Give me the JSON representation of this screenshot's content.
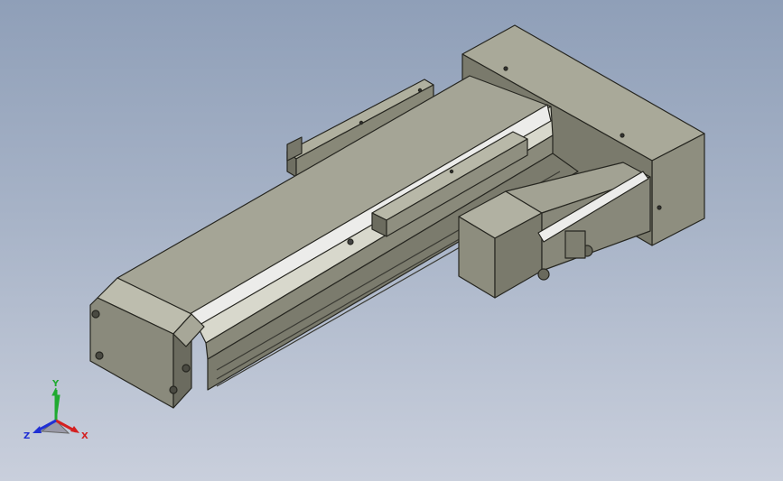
{
  "viewport": {
    "background_top": "#8f9fb8",
    "background_bottom": "#c9cfdc"
  },
  "model": {
    "body_color": "#9c9c8c",
    "body_dark": "#5f5f54",
    "body_light": "#c7c7b8",
    "edge_color": "#262620",
    "rail_highlight": "#ececea"
  },
  "triad": {
    "x_label": "X",
    "y_label": "Y",
    "z_label": "Z",
    "x_color": "#d42020",
    "y_color": "#1faa30",
    "z_color": "#2030d4"
  }
}
